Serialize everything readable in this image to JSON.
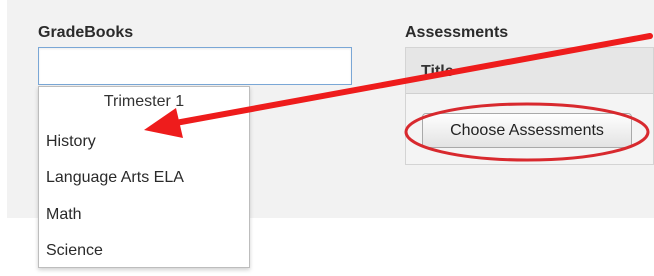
{
  "gradebooks": {
    "label": "GradeBooks",
    "search_value": "",
    "dropdown": {
      "group_header": "Trimester 1",
      "items": [
        "History",
        "Language Arts ELA",
        "Math",
        "Science"
      ]
    }
  },
  "assessments": {
    "label": "Assessments",
    "column_title": "Title",
    "choose_button": "Choose Assessments"
  },
  "annotation": {
    "arrow_color": "#ee1c1c",
    "ellipse_color": "#d8292e"
  }
}
